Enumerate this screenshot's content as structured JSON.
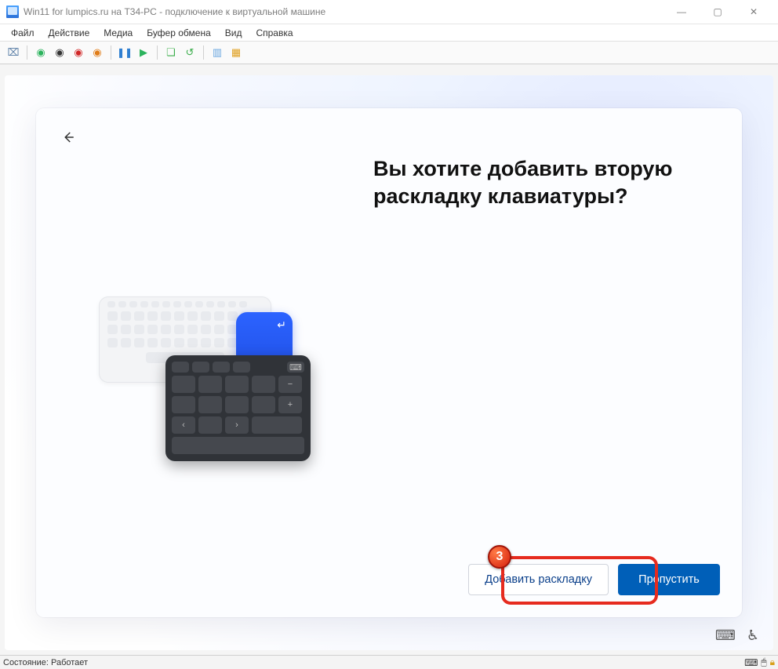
{
  "titlebar": {
    "title": "Win11 for lumpics.ru на T34-PC - подключение к виртуальной машине"
  },
  "menubar": {
    "items": [
      "Файл",
      "Действие",
      "Медиа",
      "Буфер обмена",
      "Вид",
      "Справка"
    ]
  },
  "oobe": {
    "heading": "Вы хотите добавить вторую раскладку клавиатуры?",
    "add_layout_label": "Добавить раскладку",
    "skip_label": "Пропустить"
  },
  "annotation": {
    "step": "3"
  },
  "statusbar": {
    "text": "Состояние: Работает"
  }
}
